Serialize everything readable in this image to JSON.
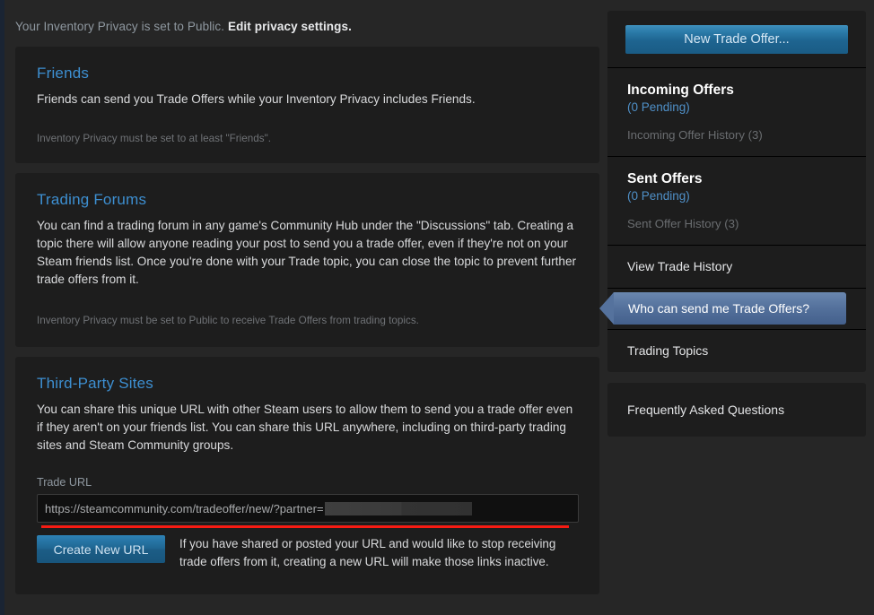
{
  "banner": {
    "text": "Your Inventory Privacy is set to Public.",
    "edit_link": "Edit privacy settings."
  },
  "cards": [
    {
      "title": "Friends",
      "body": "Friends can send you Trade Offers while your Inventory Privacy includes Friends.",
      "note": "Inventory Privacy must be set to at least \"Friends\"."
    },
    {
      "title": "Trading Forums",
      "body": "You can find a trading forum in any game's Community Hub under the \"Discussions\" tab. Creating a topic there will allow anyone reading your post to send you a trade offer, even if they're not on your Steam friends list. Once you're done with your Trade topic, you can close the topic to prevent further trade offers from it.",
      "note": "Inventory Privacy must be set to Public to receive Trade Offers from trading topics."
    },
    {
      "title": "Third-Party Sites",
      "body": "You can share this unique URL with other Steam users to allow them to send you a trade offer even if they aren't on your friends list. You can share this URL anywhere, including on third-party trading sites and Steam Community groups."
    }
  ],
  "trade_url": {
    "label": "Trade URL",
    "value": "https://steamcommunity.com/tradeoffer/new/?partner=",
    "redacted": true,
    "create_button": "Create New URL",
    "create_note": "If you have shared or posted your URL and would like to stop receiving trade offers from it, creating a new URL will make those links inactive."
  },
  "sidebar": {
    "new_trade_offer": "New Trade Offer...",
    "incoming": {
      "heading": "Incoming Offers",
      "pending": "(0 Pending)",
      "history": "Incoming Offer History (3)"
    },
    "sent": {
      "heading": "Sent Offers",
      "pending": "(0 Pending)",
      "history": "Sent Offer History (3)"
    },
    "view_trade_history": "View Trade History",
    "who_can_send": "Who can send me Trade Offers?",
    "trading_topics": "Trading Topics",
    "faq": "Frequently Asked Questions"
  },
  "colors": {
    "page_bg": "#1b2838",
    "content_bg": "#262626",
    "card_bg": "#1d1d1d",
    "heading_blue": "#3d8fd1",
    "link_blue": "#4f90c8",
    "selected_highlight": "#53709b",
    "annotation_red": "#f61b13",
    "button_blue": "#1f6591"
  }
}
